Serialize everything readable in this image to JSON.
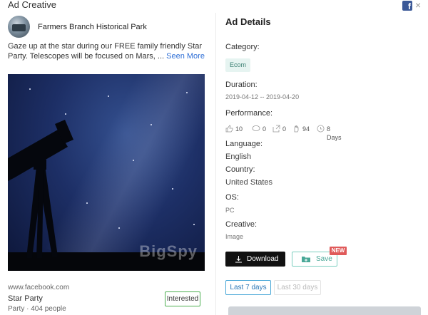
{
  "window": {
    "title": "Ad Creative",
    "facebook_icon_letter": "f",
    "close_glyph": "×"
  },
  "ad": {
    "page_name": "Farmers Branch Historical Park",
    "text": "Gaze up at the star during our FREE family friendly Star Party. Telescopes will be focused on Mars, ... ",
    "seen_more": "Seen More",
    "image_watermark": "BigSpy",
    "url": "www.facebook.com",
    "cta_title": "Star Party",
    "cta_subtitle": "Party · 404 people",
    "interested_label": "Interested"
  },
  "details": {
    "title": "Ad Details",
    "category_label": "Category:",
    "category_value": "Ecom",
    "duration_label": "Duration:",
    "duration_value": "2019-04-12 -- 2019-04-20",
    "performance_label": "Performance:",
    "performance": {
      "likes": "10",
      "comments": "0",
      "shares": "0",
      "reactions": "94",
      "days": "8 Days"
    },
    "language_label": "Language:",
    "language_value": "English",
    "country_label": "Country:",
    "country_value": "United States",
    "os_label": "OS:",
    "os_value": "PC",
    "creative_label": "Creative:",
    "creative_value": "Image"
  },
  "actions": {
    "download_label": "Download",
    "save_label": "Save",
    "new_badge": "NEW"
  },
  "ranges": {
    "active": "Last 7 days",
    "inactive": "Last 30 days"
  },
  "icons": {
    "facebook": "facebook-icon",
    "close": "close-icon",
    "like": "thumbs-up-icon",
    "comment": "comment-icon",
    "share": "share-icon",
    "reaction": "hand-icon",
    "clock": "clock-icon",
    "download": "download-icon",
    "save": "folder-plus-icon"
  },
  "colors": {
    "accent_teal": "#4aa898",
    "active_blue": "#2c78b8",
    "new_badge": "#e05a5a",
    "download_bg": "#111111",
    "link_blue": "#2f6fd6"
  }
}
